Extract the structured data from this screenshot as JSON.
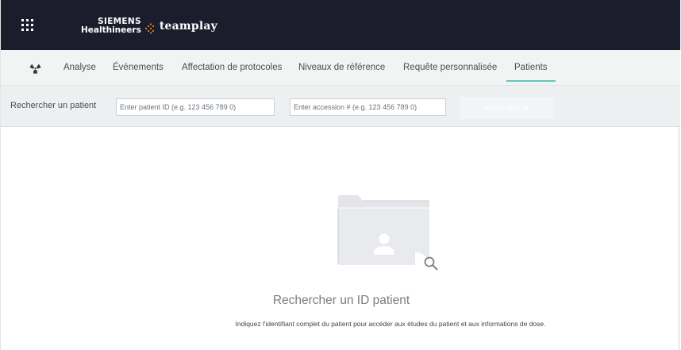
{
  "header": {
    "brand_line1": "SIEMENS",
    "brand_line2": "Healthineers",
    "product": "teamplay",
    "background_color": "#1b1d2d"
  },
  "nav": {
    "items": [
      {
        "label": "Analyse"
      },
      {
        "label": "Événements"
      },
      {
        "label": "Affectation de protocoles"
      },
      {
        "label": "Niveaux de référence"
      },
      {
        "label": "Requête personnalisée"
      },
      {
        "label": "Patients"
      }
    ],
    "active": "Patients",
    "active_color": "#62c7b8"
  },
  "search": {
    "label": "Rechercher un patient",
    "patient_id_placeholder": "Enter patient ID (e.g. 123 456 789 0)",
    "accession_placeholder": "Enter accession # (e.g. 123 456 789 0)",
    "button_label": "Rechercher"
  },
  "empty_state": {
    "title": "Rechercher un ID patient",
    "description": "Indiquez l'identifiant complet du patient pour accéder aux études du patient et aux informations de dose."
  }
}
